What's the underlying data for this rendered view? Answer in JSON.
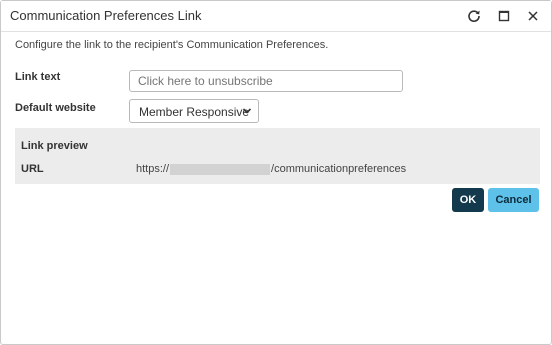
{
  "dialog": {
    "title": "Communication Preferences Link",
    "icons": {
      "refresh": "refresh-icon",
      "maximize": "maximize-icon",
      "close": "close-icon"
    }
  },
  "description": "Configure the link to the recipient's Communication Preferences.",
  "form": {
    "link_text_label": "Link text",
    "link_text_value": "",
    "link_text_placeholder": "Click here to unsubscribe",
    "default_website_label": "Default website",
    "default_website_value": "Member Responsive"
  },
  "preview": {
    "title": "Link preview",
    "url_label": "URL",
    "url_prefix": "https://",
    "url_suffix": "/communicationpreferences"
  },
  "buttons": {
    "ok": "OK",
    "cancel": "Cancel"
  },
  "colors": {
    "ok_bg": "#123a4c",
    "cancel_bg": "#5ec1ea",
    "preview_bg": "#ececec"
  }
}
